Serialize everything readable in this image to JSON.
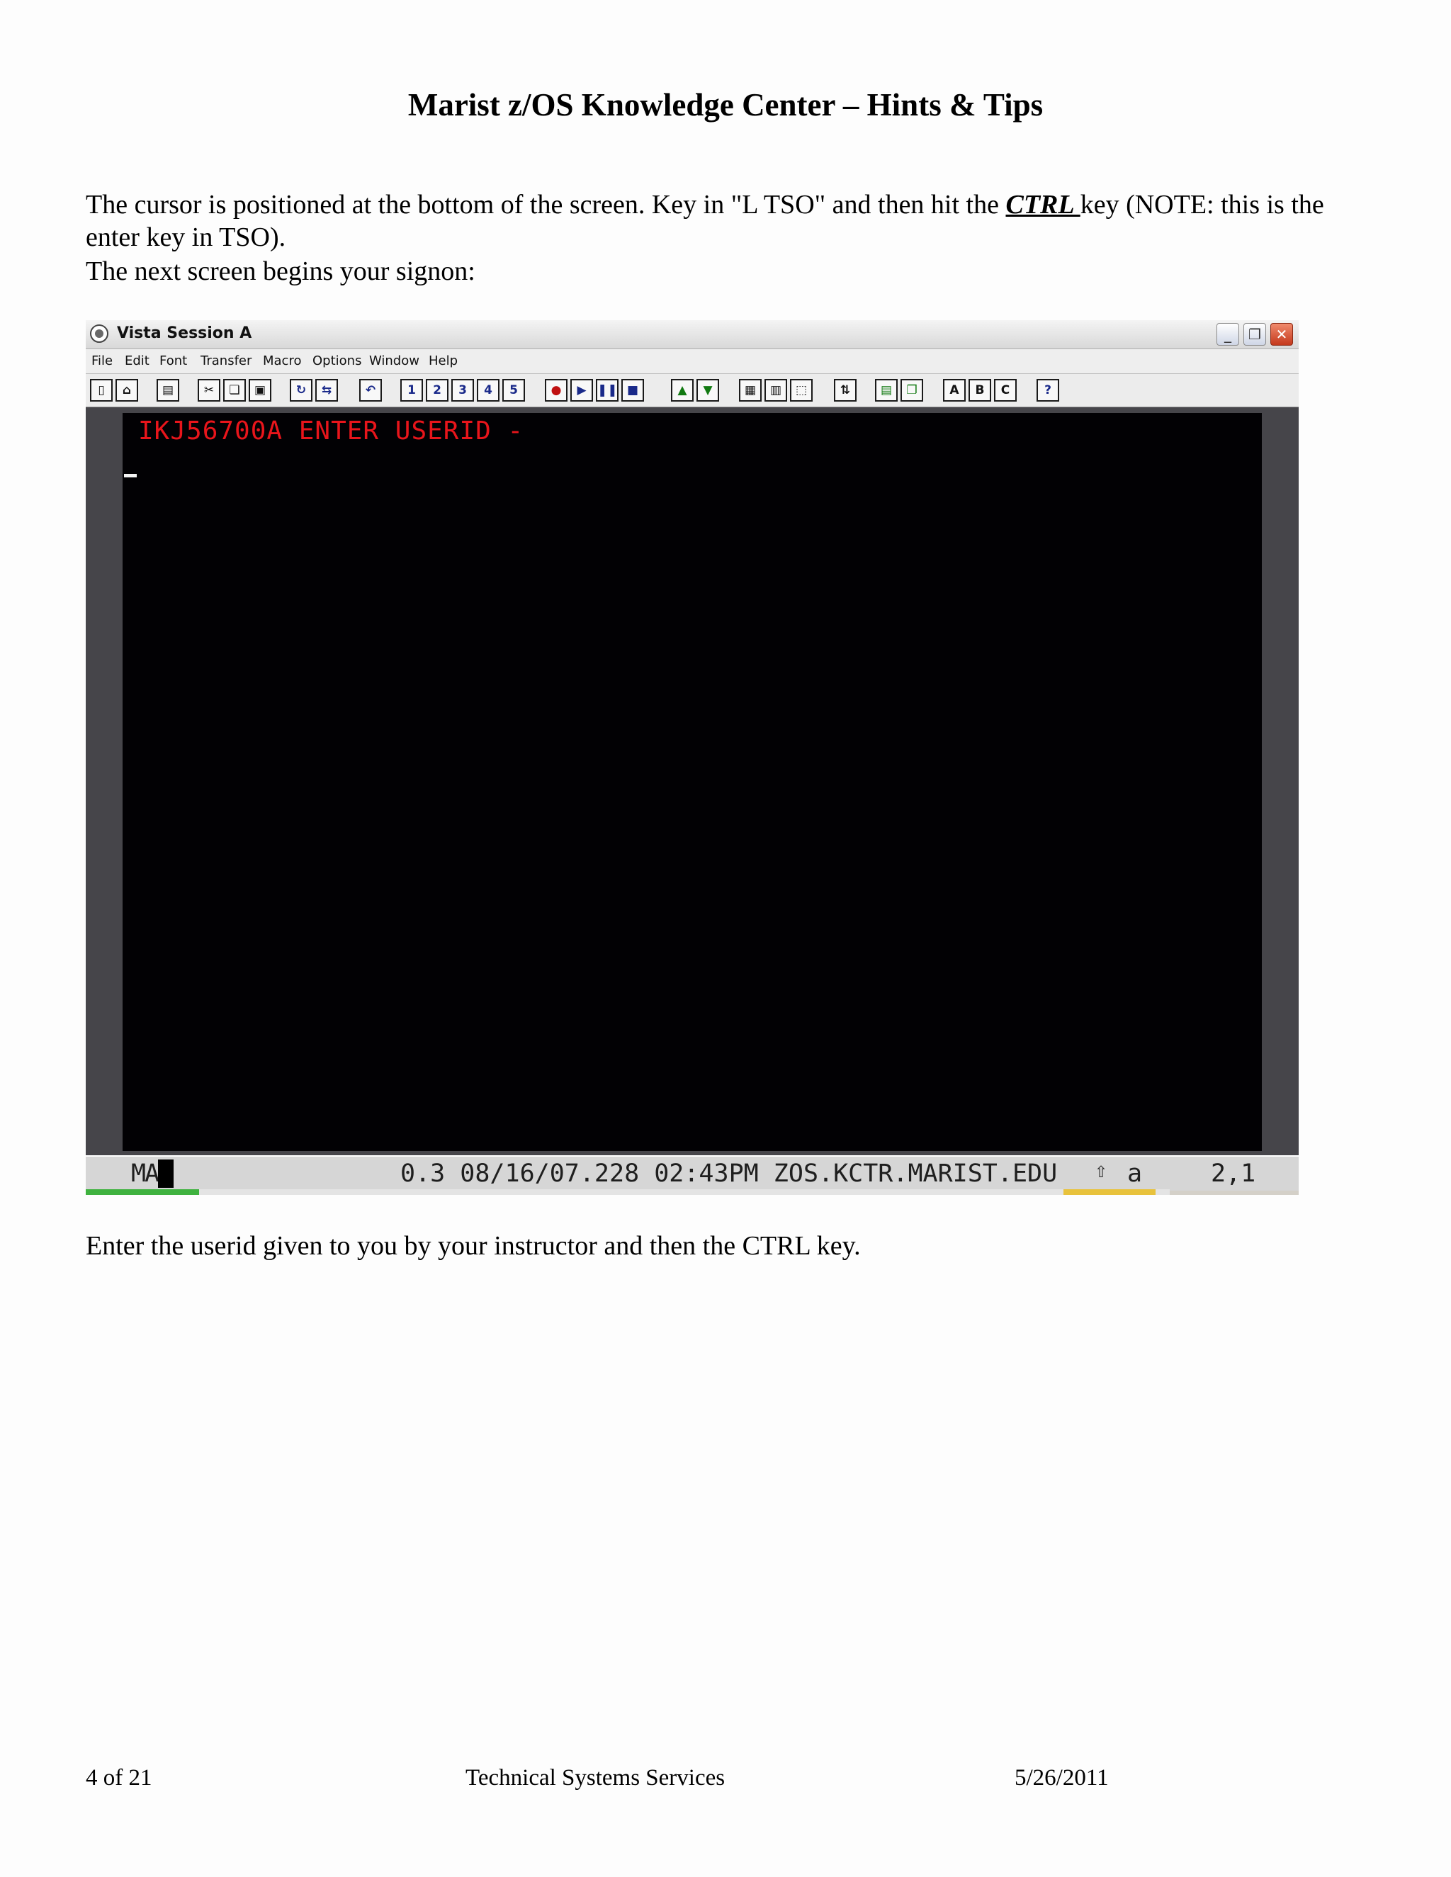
{
  "document": {
    "title": "Marist z/OS Knowledge Center – Hints & Tips",
    "para1_part1": "The cursor is positioned at the bottom of the screen.  Key in \"L TSO\" and then hit the ",
    "para1_ctrl": "CTRL ",
    "para1_part2": "key (NOTE:  this is the enter key in TSO).",
    "para2": "The next screen begins your signon:",
    "para3": "Enter the userid given to you by your instructor and then the CTRL key."
  },
  "window": {
    "title": "Vista Session A",
    "controls": [
      "_",
      "❐",
      "✕"
    ],
    "menu": [
      "File",
      "Edit",
      "Font",
      "Transfer",
      "Macro",
      "Options",
      "Window",
      "Help"
    ],
    "toolbar_buttons": [
      "1",
      "2",
      "3",
      "4",
      "5",
      "A",
      "B",
      "C",
      "?"
    ]
  },
  "terminal": {
    "message": "IKJ56700A ENTER USERID -"
  },
  "statusbar": {
    "mode": "MA",
    "info": "0.3 08/16/07.228 02:43PM ZOS.KCTR.MARIST.EDU",
    "indicator": "a",
    "cursor_pos": "2,1"
  },
  "footer": {
    "page": "4 of 21",
    "org": "Technical Systems Services",
    "date": "5/26/2011"
  }
}
